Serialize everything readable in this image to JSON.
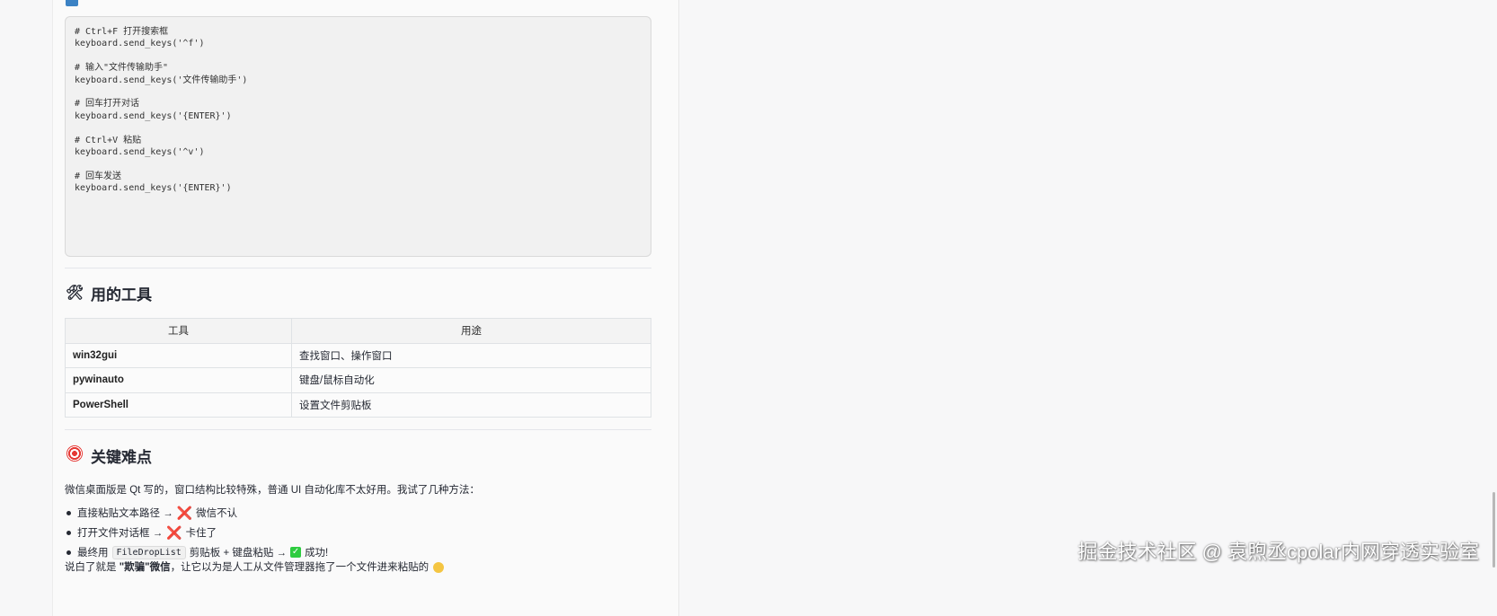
{
  "code_block": {
    "lines": [
      "# Ctrl+F 打开搜索框",
      "keyboard.send_keys('^f')",
      "",
      "# 输入\"文件传输助手\"",
      "keyboard.send_keys('文件传输助手')",
      "",
      "# 回车打开对话",
      "keyboard.send_keys('{ENTER}')",
      "",
      "# Ctrl+V 粘贴",
      "keyboard.send_keys('^v')",
      "",
      "# 回车发送",
      "keyboard.send_keys('{ENTER}')"
    ]
  },
  "tools_section": {
    "icon": "tools-icon",
    "heading": "用的工具",
    "table": {
      "headers": [
        "工具",
        "用途"
      ],
      "rows": [
        [
          "win32gui",
          "查找窗口、操作窗口"
        ],
        [
          "pywinauto",
          "键盘/鼠标自动化"
        ],
        [
          "PowerShell",
          "设置文件剪贴板"
        ]
      ]
    }
  },
  "difficulty_section": {
    "icon": "target-icon",
    "heading": "关键难点",
    "intro": "微信桌面版是 Qt 写的，窗口结构比较特殊，普通 UI 自动化库不太好用。我试了几种方法：",
    "methods": [
      {
        "text": "直接粘贴文本路径 → ",
        "mark": "❌",
        "result": " 微信不认"
      },
      {
        "text": "打开文件对话框 → ",
        "mark": "❌",
        "result": " 卡住了"
      },
      {
        "prefix": "最终用 ",
        "code": "FileDropList",
        "text": " 剪贴板 + 键盘粘贴 → ",
        "mark": "✅",
        "result": " 成功!"
      }
    ],
    "summary_prefix": "说白了就是 ",
    "summary_bold": "\"欺骗\"微信",
    "summary_rest": "，让它以为是人工从文件管理器拖了一个文件进来粘贴的 "
  },
  "watermark": "掘金技术社区 @ 袁煦丞cpolar内网穿透实验室",
  "colors": {
    "page_bg": "#f7f7f8",
    "code_bg": "#f1f1f1",
    "cross": "#e0245e",
    "check": "#2ecc40"
  }
}
